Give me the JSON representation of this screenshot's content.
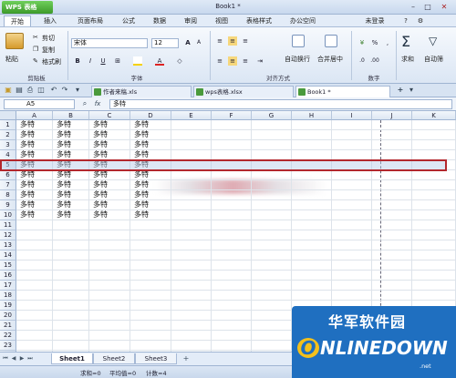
{
  "app": {
    "name": "WPS 表格",
    "title": "Book1 *"
  },
  "menu": [
    "开始",
    "插入",
    "页面布局",
    "公式",
    "数据",
    "审阅",
    "视图",
    "表格样式",
    "办公空间"
  ],
  "menu_right": {
    "login": "未登录"
  },
  "ribbon": {
    "paste": "粘贴",
    "cut": "剪切",
    "copy": "复制",
    "format_painter": "格式刷",
    "clipboard_label": "剪贴板",
    "font_name": "宋体",
    "font_size": "12",
    "font_label": "字体",
    "align_label": "对齐方式",
    "autowrap": "自动换行",
    "merge_center": "合并居中",
    "number_label": "数字",
    "sum": "求和",
    "autofilter": "自动筛",
    "bold": "B",
    "italic": "I",
    "underline": "U",
    "percent": "%",
    "grow_font": "A",
    "shrink_font": "A"
  },
  "doc_tabs": [
    {
      "label": "作者来稿.xls"
    },
    {
      "label": "wps表格.xlsx"
    },
    {
      "label": "Book1 *"
    }
  ],
  "formula": {
    "cell_ref": "A5",
    "fx": "fx",
    "value": "多特"
  },
  "columns": [
    "A",
    "B",
    "C",
    "D",
    "E",
    "F",
    "G",
    "H",
    "I",
    "J",
    "K"
  ],
  "rows": [
    "1",
    "2",
    "3",
    "4",
    "5",
    "6",
    "7",
    "8",
    "9",
    "10",
    "11",
    "12",
    "13",
    "14",
    "15",
    "16",
    "17",
    "18",
    "19",
    "20",
    "21",
    "22",
    "23",
    "24"
  ],
  "cell_text": "多特",
  "sheets": [
    "Sheet1",
    "Sheet2",
    "Sheet3"
  ],
  "status": {
    "sum": "求和=0",
    "avg": "平均值=0",
    "count": "计数=4"
  },
  "watermark": {
    "cn": "华军软件园",
    "en": "NLINEDOWN",
    "o": "O",
    "suffix": ".net"
  },
  "colors": {
    "accent": "#3d9a2a",
    "selection": "#b3272d",
    "header": "#dde7f3"
  }
}
